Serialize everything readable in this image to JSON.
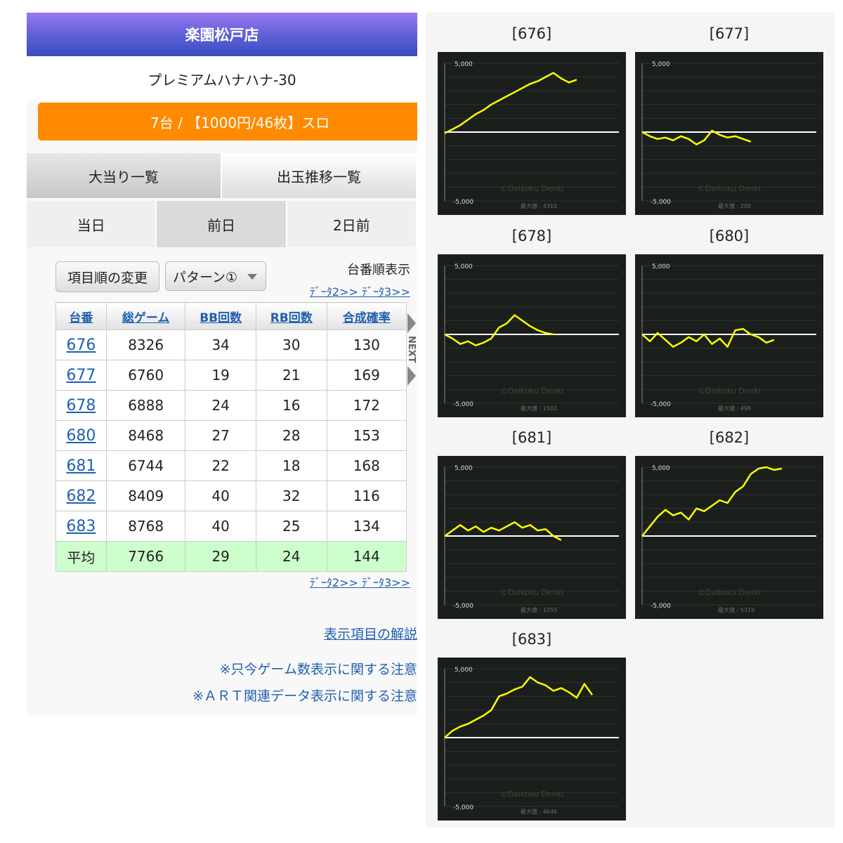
{
  "store": {
    "name": "楽園松戸店"
  },
  "machine": {
    "name": "プレミアムハナハナ-30",
    "units_info": "7台 / 【1000円/46枚】スロ"
  },
  "tabs_main": [
    "大当り一覧",
    "出玉推移一覧"
  ],
  "tabs_day": [
    "当日",
    "前日",
    "2日前"
  ],
  "controls": {
    "order_button": "項目順の変更",
    "pattern_select": "パターン①",
    "order_label": "台番順表示",
    "data2": "ﾃﾞｰﾀ2>>",
    "data3": "ﾃﾞｰﾀ3>>"
  },
  "table": {
    "headers": [
      "台番",
      "総ゲーム",
      "BB回数",
      "RB回数",
      "合成確率"
    ],
    "rows": [
      [
        "676",
        "8326",
        "34",
        "30",
        "130"
      ],
      [
        "677",
        "6760",
        "19",
        "21",
        "169"
      ],
      [
        "678",
        "6888",
        "24",
        "16",
        "172"
      ],
      [
        "680",
        "8468",
        "27",
        "28",
        "153"
      ],
      [
        "681",
        "6744",
        "22",
        "18",
        "168"
      ],
      [
        "682",
        "8409",
        "40",
        "32",
        "116"
      ],
      [
        "683",
        "8768",
        "40",
        "25",
        "134"
      ]
    ],
    "average": [
      "平均",
      "7766",
      "29",
      "24",
      "144"
    ]
  },
  "next_label": "NEXT",
  "footer": {
    "explain": "表示項目の解説",
    "note1": "※只今ゲーム数表示に関する注意",
    "note2": "※ＡＲＴ関連データ表示に関する注意"
  },
  "graphs_meta": {
    "top_tick": "5,000",
    "bottom_tick": "-5,000",
    "watermark": "©Daikoku Denki",
    "max_label": "最大値 :"
  },
  "colors": {
    "header_purple": "#9a78ef",
    "header_blue": "#3b4cc0",
    "unit_bar_orange": "#ff8a00",
    "link_blue": "#2060b0",
    "avg_row_green": "#ccffcc",
    "graph_bg": "#1b1f1b",
    "graph_line": "#ffff00"
  },
  "chart_data": [
    {
      "type": "line",
      "title": "[676]",
      "ylim": [
        -5000,
        5000
      ],
      "max_value": "4310",
      "y": [
        -80,
        200,
        500,
        900,
        1300,
        1600,
        2000,
        2300,
        2600,
        2900,
        3200,
        3500,
        3700,
        4000,
        4300,
        3900,
        3600,
        3800
      ]
    },
    {
      "type": "line",
      "title": "[677]",
      "ylim": [
        -5000,
        5000
      ],
      "max_value": "200",
      "y": [
        0,
        -300,
        -500,
        -400,
        -600,
        -300,
        -500,
        -900,
        -600,
        100,
        -200,
        -400,
        -300,
        -500,
        -700
      ]
    },
    {
      "type": "line",
      "title": "[678]",
      "ylim": [
        -5000,
        5000
      ],
      "max_value": "1502",
      "y": [
        0,
        -300,
        -700,
        -500,
        -800,
        -600,
        -300,
        500,
        800,
        1400,
        1000,
        600,
        300,
        100,
        0
      ]
    },
    {
      "type": "line",
      "title": "[680]",
      "ylim": [
        -5000,
        5000
      ],
      "max_value": "498",
      "y": [
        0,
        -500,
        100,
        -400,
        -900,
        -600,
        -200,
        -500,
        0,
        -700,
        -300,
        -900,
        300,
        400,
        0,
        -200,
        -600,
        -400
      ]
    },
    {
      "type": "line",
      "title": "[681]",
      "ylim": [
        -5000,
        5000
      ],
      "max_value": "1055",
      "y": [
        0,
        400,
        800,
        400,
        700,
        300,
        600,
        400,
        700,
        1000,
        600,
        800,
        400,
        500,
        0,
        -300
      ]
    },
    {
      "type": "line",
      "title": "[682]",
      "ylim": [
        -5000,
        5000
      ],
      "max_value": "5319",
      "y": [
        0,
        700,
        1400,
        1900,
        1500,
        1700,
        1200,
        2000,
        1800,
        2200,
        2600,
        2400,
        3200,
        3600,
        4500,
        4900,
        5000,
        4800,
        4900
      ]
    },
    {
      "type": "line",
      "title": "[683]",
      "ylim": [
        -5000,
        5000
      ],
      "max_value": "4646",
      "y": [
        0,
        500,
        800,
        1000,
        1300,
        1600,
        2000,
        3000,
        3200,
        3500,
        3700,
        4400,
        4000,
        3800,
        3400,
        3600,
        3300,
        2900,
        3900,
        3100
      ]
    }
  ]
}
